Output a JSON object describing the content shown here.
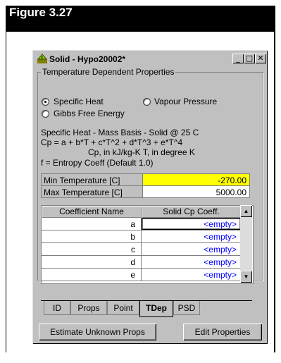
{
  "figure": {
    "label": "Figure 3.27"
  },
  "window": {
    "title": "Solid - Hypo20002*",
    "controls": {
      "minimize": "_",
      "maximize": "□",
      "close": "✕"
    },
    "icon": "solid-component-icon"
  },
  "group": {
    "title": "Temperature Dependent Properties",
    "options": {
      "specific_heat": "Specific Heat",
      "vapour_pressure": "Vapour Pressure",
      "gibbs": "Gibbs Free Energy"
    },
    "selected": "Specific Heat"
  },
  "info": {
    "line1": "Specific Heat - Mass Basis - Solid @ 25 C",
    "line2": "Cp = a + b*T + c*T^2 + d*T^3 + e*T^4",
    "line3": "Cp, in kJ/kg-K  T, in degree K",
    "line4": "f = Entropy Coeff  (Default 1.0)"
  },
  "temps": {
    "min_label": "Min Temperature [C]",
    "min_value": "-270.00",
    "max_label": "Max Temperature [C]",
    "max_value": "5000.00"
  },
  "coeffs": {
    "col_name": "Coefficient Name",
    "col_value": "Solid Cp Coeff.",
    "rows": [
      {
        "name": "a",
        "value": "<empty>"
      },
      {
        "name": "b",
        "value": "<empty>"
      },
      {
        "name": "c",
        "value": "<empty>"
      },
      {
        "name": "d",
        "value": "<empty>"
      },
      {
        "name": "e",
        "value": "<empty>"
      }
    ]
  },
  "tabs": [
    "ID",
    "Props",
    "Point",
    "TDep",
    "PSD"
  ],
  "active_tab": "TDep",
  "buttons": {
    "estimate": "Estimate Unknown Props",
    "edit": "Edit Properties"
  },
  "colors": {
    "highlight": "#ffff00",
    "empty_text": "#0000ff",
    "window": "#c0c0c0"
  }
}
